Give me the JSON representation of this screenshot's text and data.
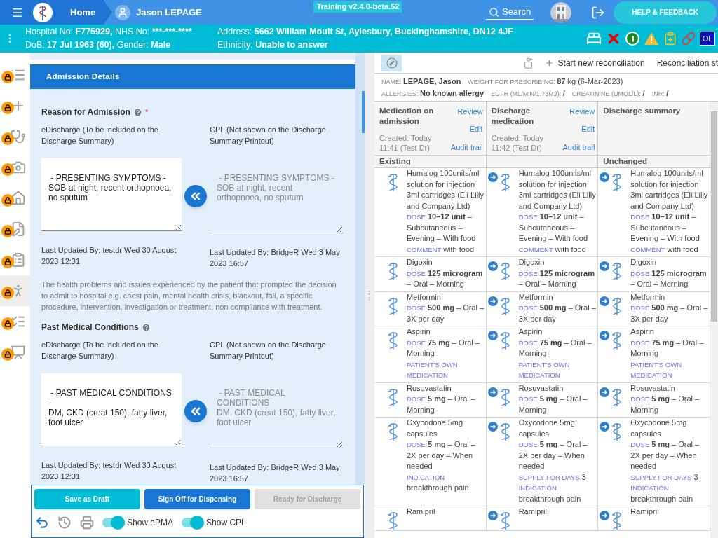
{
  "header": {
    "home": "Home",
    "patient_name": "Jason LEPAGE",
    "environment": "Training v2.4.0-beta.52",
    "search": "Search",
    "help": "HELP & FEEDBACK"
  },
  "patient_bar": {
    "lines_left": [
      [
        {
          "label": "Hospital No:",
          "value": "F775929,"
        },
        {
          "label": "NHS No:",
          "value": "***-***-****"
        }
      ],
      [
        {
          "label": "DoB:",
          "value": "17 Jul 1963 (60),"
        },
        {
          "label": "Gender:",
          "value": "Male"
        }
      ]
    ],
    "lines_right": [
      [
        {
          "label": "Address:",
          "value": "5662 William Moult St, Aylesbury, Buckinghamshire, DN12 4JF"
        }
      ],
      [
        {
          "label": "Ethnicity:",
          "value": "Unable to answer"
        }
      ]
    ],
    "badge": "OL"
  },
  "sidebar": {
    "items": [
      {
        "locked": true,
        "selected": false
      },
      {
        "locked": true,
        "selected": false
      },
      {
        "locked": true,
        "selected": false
      },
      {
        "locked": true,
        "selected": false
      },
      {
        "locked": true,
        "selected": false
      },
      {
        "locked": true,
        "selected": false
      },
      {
        "locked": true,
        "selected": false
      },
      {
        "locked": true,
        "selected": true
      },
      {
        "locked": true,
        "selected": false
      },
      {
        "locked": true,
        "selected": false
      }
    ]
  },
  "admission": {
    "title": "Admission Details",
    "sections": [
      {
        "title": "Reason for Admission",
        "required_mark": "*",
        "left_label": "eDischarge (To be included on the Discharge Summary)",
        "right_label": "CPL (Not shown on the Discharge Summary Printout)",
        "left_value": " - PRESENTING SYMPTOMS -\nSOB at night, recent orthopnoea, no sputum",
        "right_value": " - PRESENTING SYMPTOMS -\nSOB at night, recent orthopnoea, no sputum",
        "left_updated": "Last Updated By: testdr Wed 30 August 2023 12:31",
        "right_updated": "Last Updated By: BridgeR Wed 3 May 2023 16:57",
        "help": "The health problems and issues experienced by the patient that prompted the decision to admit to hospital e.g. chest pain, mental health crisis, blackout, fall,  a specific procedure, intervention, investigation or treatment, non compliance with treatment."
      },
      {
        "title": "Past Medical Conditions",
        "left_label": "eDischarge (To be included on the Discharge Summary)",
        "right_label": "CPL (Not shown on the Discharge Summary Printout)",
        "left_value": " - PAST MEDICAL CONDITIONS -\nDM, CKD (creat 150), fatty liver, foot ulcer",
        "right_value": " - PAST MEDICAL CONDITIONS -\nDM, CKD (creat 150), fatty liver, foot ulcer",
        "left_updated": "Last Updated By: testdr Wed 30 August 2023 12:31",
        "right_updated": "Last Updated By: BridgeR Wed 3 May 2023 16:57"
      }
    ],
    "buttons": [
      {
        "label": "Save as Draft",
        "kind": "secondary",
        "disabled": false
      },
      {
        "label": "Sign Off for Dispensing",
        "kind": "primary",
        "disabled": false
      },
      {
        "label": "Ready for Discharge",
        "kind": "neutral",
        "disabled": true
      }
    ],
    "tools": [
      {
        "kind": "undo",
        "disabled": false
      },
      {
        "kind": "history",
        "disabled": true
      },
      {
        "kind": "print",
        "disabled": true
      }
    ],
    "toggles": [
      {
        "label": "Show ePMA",
        "on": true
      },
      {
        "label": "Show CPL",
        "on": true
      }
    ]
  },
  "reconciliation": {
    "toolbar": {
      "pill_filter_selected": true,
      "start": "Start new reconciliation",
      "status": "Reconciliation st"
    },
    "info": [
      [
        {
          "label": "NAME:",
          "value": "**LEPAGE, Jason**"
        },
        {
          "label": "WEIGHT FOR PRESCRIBING:",
          "value": "**87** kg (6-Mar-2023)"
        }
      ],
      [
        {
          "label": "ALLERGIES:",
          "value": "**No known allergy**"
        },
        {
          "label": "EGFR (ML/MIN/1.73M2):",
          "value": "**/**"
        },
        {
          "label": "CREATININE (UMOL/L):",
          "value": "**/**"
        },
        {
          "label": "INR:",
          "value": "**/**"
        }
      ]
    ],
    "columns": [
      {
        "title": "Medication on admission",
        "links": [
          "Review",
          "Edit",
          "Audit trail"
        ],
        "created": "Created: Today 11:41 (Test Dr)"
      },
      {
        "title": "Discharge medication",
        "links": [
          "Review",
          "Edit",
          "Audit trail"
        ],
        "created": "Created: Today 11:42 (Test Dr)"
      },
      {
        "title": "Discharge summary"
      }
    ],
    "group_labels": {
      "existing": "Existing",
      "unchanged": "Unchanged"
    },
    "rows": [
      {
        "cells": [
          {
            "linked": false,
            "name": "Humalog 100units/ml solution for injection 3ml cartridges (Eli Lilly and Company Ltd)",
            "details": [
              {
                "label": "DOSE",
                "text": "**10–12 unit** – Subcutaneous – Evening – With food"
              },
              {
                "label": "COMMENT",
                "text": "with food"
              }
            ]
          },
          {
            "linked": true,
            "name": "Humalog 100units/ml solution for injection 3ml cartridges (Eli Lilly and Company Ltd)",
            "details": [
              {
                "label": "DOSE",
                "text": "**10–12 unit** – Subcutaneous – Evening – With food"
              },
              {
                "label": "COMMENT",
                "text": "with food"
              }
            ]
          },
          {
            "linked": true,
            "name": "Humalog 100units/ml solution for injection 3ml cartridges (Eli Lilly and Company Ltd)",
            "details": [
              {
                "label": "DOSE",
                "text": "**10–12 unit** – Subcutaneous – Evening – With food"
              },
              {
                "label": "COMMENT",
                "text": "with food"
              }
            ]
          }
        ]
      },
      {
        "cells": [
          {
            "linked": false,
            "name": "Digoxin",
            "details": [
              {
                "label": "DOSE",
                "text": "**125 microgram** – Oral – Morning"
              }
            ]
          },
          {
            "linked": true,
            "name": "Digoxin",
            "details": [
              {
                "label": "DOSE",
                "text": "**125 microgram** – Oral – Morning"
              }
            ]
          },
          {
            "linked": true,
            "name": "Digoxin",
            "details": [
              {
                "label": "DOSE",
                "text": "**125 microgram** – Oral – Morning"
              }
            ]
          }
        ]
      },
      {
        "cells": [
          {
            "linked": false,
            "name": "Metformin",
            "details": [
              {
                "label": "DOSE",
                "text": "**500 mg** – Oral – 3X per day"
              }
            ]
          },
          {
            "linked": true,
            "name": "Metformin",
            "details": [
              {
                "label": "DOSE",
                "text": "**500 mg** – Oral – 3X per day"
              }
            ]
          },
          {
            "linked": true,
            "name": "Metformin",
            "details": [
              {
                "label": "DOSE",
                "text": "**500 mg** – Oral – 3X per day"
              }
            ]
          }
        ]
      },
      {
        "cells": [
          {
            "linked": false,
            "name": "Aspirin",
            "details": [
              {
                "label": "DOSE",
                "text": "**75 mg** – Oral – Morning"
              },
              {
                "label": "PATIENT'S OWN MEDICATION"
              }
            ]
          },
          {
            "linked": true,
            "name": "Aspirin",
            "details": [
              {
                "label": "DOSE",
                "text": "**75 mg** – Oral – Morning"
              },
              {
                "label": "PATIENT'S OWN MEDICATION"
              }
            ]
          },
          {
            "linked": true,
            "name": "Aspirin",
            "details": [
              {
                "label": "DOSE",
                "text": "**75 mg** – Oral – Morning"
              },
              {
                "label": "PATIENT'S OWN MEDICATION"
              }
            ]
          }
        ]
      },
      {
        "cells": [
          {
            "linked": false,
            "name": "Rosuvastatin",
            "details": [
              {
                "label": "DOSE",
                "text": "**5 mg** – Oral – Morning"
              }
            ]
          },
          {
            "linked": true,
            "name": "Rosuvastatin",
            "details": [
              {
                "label": "DOSE",
                "text": "**5 mg** – Oral – Morning"
              }
            ]
          },
          {
            "linked": true,
            "name": "Rosuvastatin",
            "details": [
              {
                "label": "DOSE",
                "text": "**5 mg** – Oral – Morning"
              }
            ]
          }
        ]
      },
      {
        "cells": [
          {
            "linked": false,
            "name": "Oxycodone 5mg capsules",
            "details": [
              {
                "label": "DOSE",
                "text": "**5 mg** – Oral – 2X per day – When needed"
              },
              {
                "label": "INDICATION",
                "text": "breakthrough pain"
              }
            ]
          },
          {
            "linked": true,
            "name": "Oxycodone 5mg capsules",
            "details": [
              {
                "label": "DOSE",
                "text": "**5 mg** – Oral – 2X per day – When needed"
              },
              {
                "label": "SUPPLY FOR DAYS",
                "text": "3"
              },
              {
                "label": "INDICATION",
                "text": "breakthrough pain"
              }
            ]
          },
          {
            "linked": true,
            "name": "Oxycodone 5mg capsules",
            "details": [
              {
                "label": "DOSE",
                "text": "**5 mg** – Oral – 2X per day – When needed"
              },
              {
                "label": "SUPPLY FOR DAYS",
                "text": "3"
              },
              {
                "label": "INDICATION",
                "text": "breakthrough pain"
              }
            ]
          }
        ]
      },
      {
        "cells": [
          {
            "linked": false,
            "name": "Ramipril"
          },
          {
            "linked": true,
            "name": "Ramipril"
          },
          {
            "linked": true,
            "name": "Ramipril"
          }
        ]
      }
    ]
  }
}
